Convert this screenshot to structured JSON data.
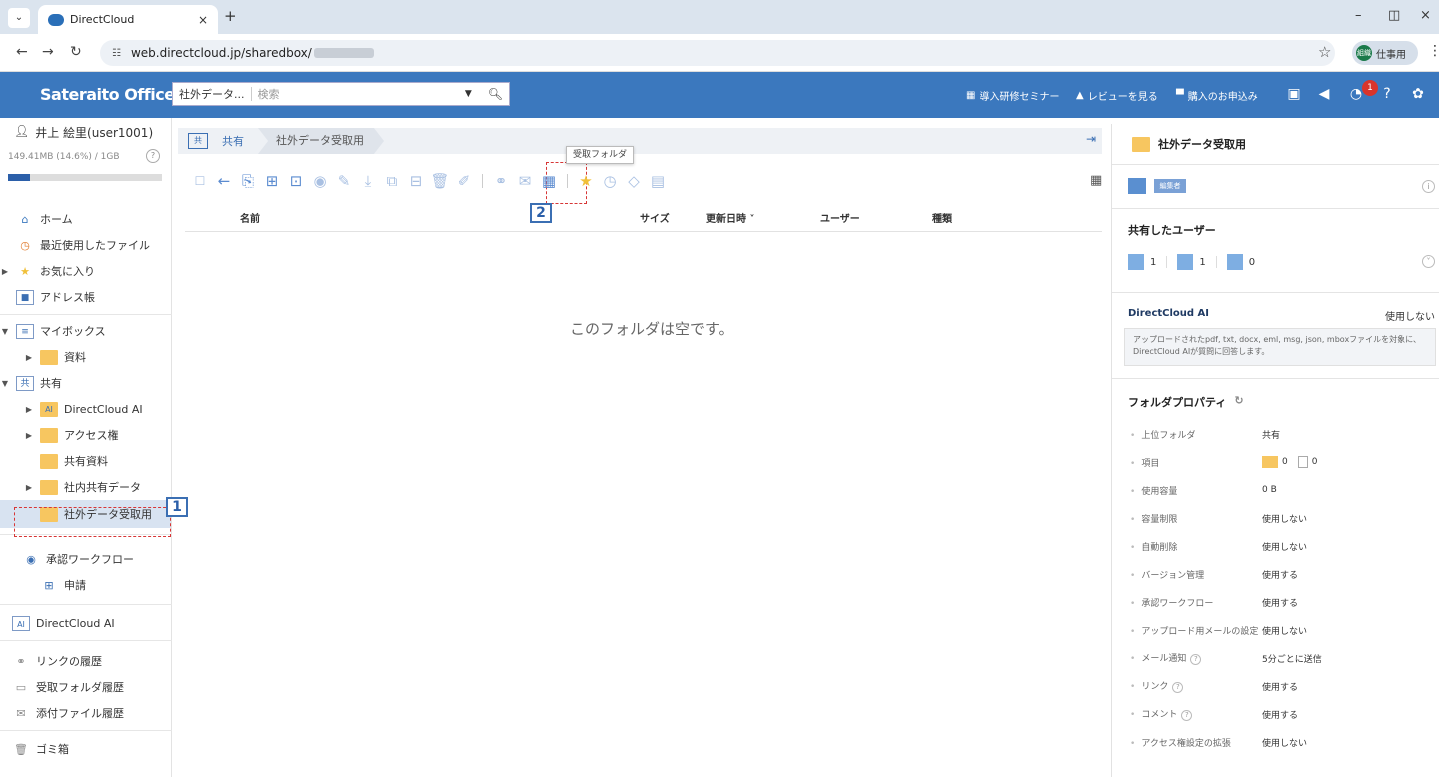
{
  "browser": {
    "tab_title": "DirectCloud",
    "url": "web.directcloud.jp/sharedbox/",
    "profile_label": "仕事用",
    "profile_initials": "組織"
  },
  "app": {
    "brand": "Sateraito Office",
    "search_scope": "社外データ...",
    "search_placeholder": "検索",
    "header_links": [
      "導入研修セミナー",
      "レビューを見る",
      "購入のお申込み"
    ],
    "notification_count": "1"
  },
  "sidebar": {
    "user": "井上 絵里(user1001)",
    "quota_text": "149.41MB (14.6%) / 1GB",
    "quota_fraction": 0.146,
    "items": {
      "home": "ホーム",
      "recent": "最近使用したファイル",
      "favorites": "お気に入り",
      "address_book": "アドレス帳",
      "mybox": "マイボックス",
      "shiryo": "資料",
      "shared": "共有",
      "directcloud_ai": "DirectCloud AI",
      "access": "アクセス権",
      "shared_docs": "共有資料",
      "internal_data": "社内共有データ",
      "external_receive": "社外データ受取用",
      "workflow": "承認ワークフロー",
      "apply": "申請",
      "directcloud_ai_root": "DirectCloud AI",
      "link_history": "リンクの履歴",
      "receive_history": "受取フォルダ履歴",
      "attach_history": "添付ファイル履歴",
      "trash": "ゴミ箱"
    }
  },
  "callouts": {
    "one": "1",
    "two": "2"
  },
  "main": {
    "breadcrumb_root": "共有",
    "breadcrumb_current": "社外データ受取用",
    "tooltip": "受取フォルダ",
    "columns": {
      "name": "名前",
      "size": "サイズ",
      "updated": "更新日時 ˅",
      "user": "ユーザー",
      "type": "種類"
    },
    "empty_message": "このフォルダは空です。"
  },
  "panel": {
    "folder_title": "社外データ受取用",
    "permission_badge": "編集者",
    "shared_users_heading": "共有したユーザー",
    "user_counts": [
      "1",
      "1",
      "0"
    ],
    "ai_title": "DirectCloud AI",
    "ai_value": "使用しない",
    "ai_desc_1": "アップロードされたpdf, txt, docx, eml, msg, json, mboxファイルを対象に、",
    "ai_desc_2": "DirectCloud AIが質問に回答します。",
    "props_heading": "フォルダプロパティ",
    "props": [
      {
        "k": "上位フォルダ",
        "v": "共有"
      },
      {
        "k": "項目",
        "v": ""
      },
      {
        "k": "使用容量",
        "v": "0 B"
      },
      {
        "k": "容量制限",
        "v": "使用しない"
      },
      {
        "k": "自動削除",
        "v": "使用しない"
      },
      {
        "k": "バージョン管理",
        "v": "使用する"
      },
      {
        "k": "承認ワークフロー",
        "v": "使用する"
      },
      {
        "k": "アップロード用メールの設定",
        "v": "使用しない"
      },
      {
        "k": "メール通知",
        "v": "5分ごとに送信"
      },
      {
        "k": "リンク",
        "v": "使用する"
      },
      {
        "k": "コメント",
        "v": "使用する"
      },
      {
        "k": "アクセス権設定の拡張",
        "v": "使用しない"
      }
    ],
    "items_folders": "0",
    "items_files": "0"
  }
}
